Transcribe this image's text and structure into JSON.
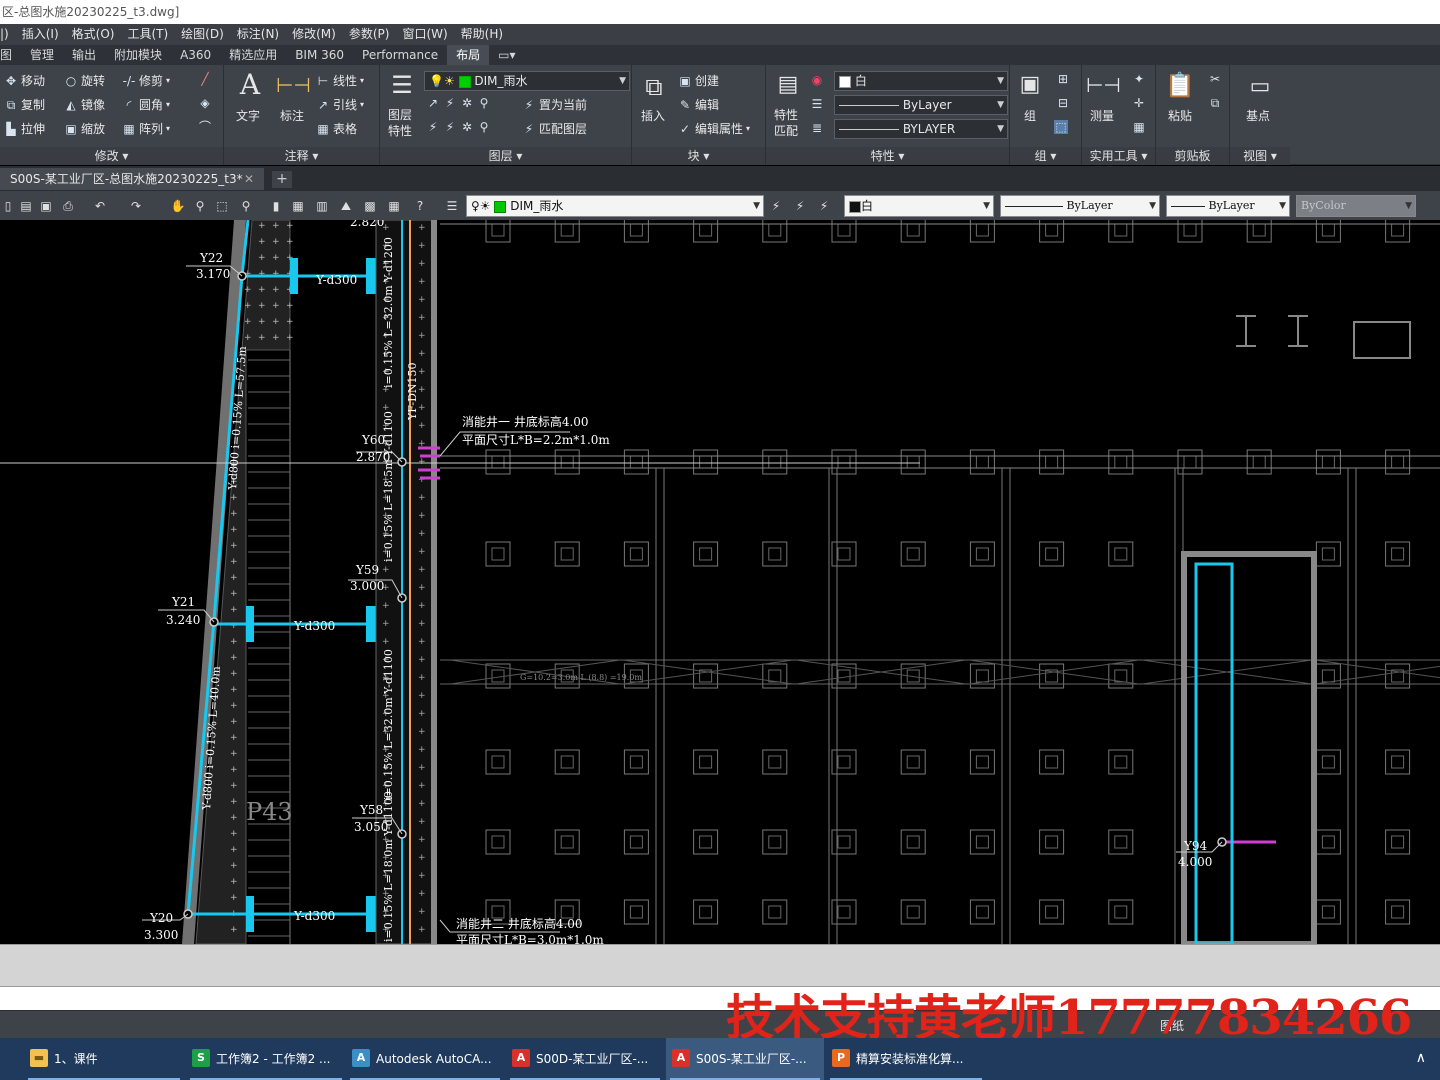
{
  "window": {
    "title": "区-总图水施20230225_t3.dwg]"
  },
  "menu": [
    "|)",
    "插入(I)",
    "格式(O)",
    "工具(T)",
    "绘图(D)",
    "标注(N)",
    "修改(M)",
    "参数(P)",
    "窗口(W)",
    "帮助(H)"
  ],
  "ribbon_tabs": [
    "图",
    "管理",
    "输出",
    "附加模块",
    "A360",
    "精选应用",
    "BIM 360",
    "Performance",
    "布局"
  ],
  "ribbon_active_tab": "布局",
  "ribbon": {
    "modify": {
      "title": "修改",
      "move": "移动",
      "rotate": "旋转",
      "trim": "修剪",
      "copy": "复制",
      "mirror": "镜像",
      "fillet": "圆角",
      "stretch": "拉伸",
      "scale": "缩放",
      "array": "阵列"
    },
    "annotation": {
      "title": "注释",
      "text": "文字",
      "dim": "标注",
      "linetype": "线性",
      "leader": "引线",
      "table": "表格"
    },
    "layers": {
      "title": "图层",
      "props": "图层\n特性",
      "current_layer": "DIM_雨水",
      "set_current": "置为当前",
      "match_layer": "匹配图层"
    },
    "block": {
      "title": "块",
      "insert": "插入",
      "create": "创建",
      "edit": "编辑",
      "edit_attr": "编辑属性"
    },
    "properties": {
      "title": "特性",
      "match": "特性\n匹配",
      "color": "白",
      "linetype": "ByLayer",
      "lineweight": "BYLAYER"
    },
    "groups": {
      "title": "组",
      "group": "组"
    },
    "utilities": {
      "title": "实用工具",
      "measure": "测量"
    },
    "clipboard": {
      "title": "剪贴板",
      "paste": "粘贴"
    },
    "view": {
      "title": "视图",
      "base": "基点"
    }
  },
  "doc_tab": {
    "label": "S00S-某工业厂区-总图水施20230225_t3*",
    "close": "✕",
    "new": "+"
  },
  "toolbar": {
    "layer": "DIM_雨水",
    "color": "白",
    "linetype": "ByLayer",
    "lineweight": "ByLayer",
    "plotstyle": "ByColor"
  },
  "drawing": {
    "labels": {
      "y22": "Y22",
      "y22_elev": "3.170",
      "y21": "Y21",
      "y21_elev": "3.240",
      "y20": "Y20",
      "y20_elev": "3.300",
      "y60": "Y60",
      "y60_elev": "2.870",
      "y59": "Y59",
      "y59_elev": "3.000",
      "y58": "Y58",
      "y58_elev": "3.050",
      "y94": "Y94",
      "y94_elev": "4.000",
      "top_elev": "2.820",
      "pipe_d300_a": "Y-d300",
      "pipe_d300_b": "Y-d300",
      "pipe_d300_c": "Y-d300",
      "well1_title": "消能井一 井底标高4.00",
      "well1_size": "平面尺寸L*B=2.2m*1.0m",
      "well2_title": "消能井二 井底标高4.00",
      "well2_size": "平面尺寸L*B=3.0m*1.0m",
      "v_1200": "i=0.15% L=32.0m   Y-d1200",
      "v_dn150": "YF-DN150",
      "v_1100a": "i=0.15% L=18.5m   Y-d1100",
      "v_1100b": "i=0.15% L=32.0m   Y-d1100",
      "v_1100c": "i=0.15% L=18.0m   Y-d1100",
      "v_d800a": "Y-d800   i=0.15% L=57.5m",
      "v_d800b": "Y-d800   i=0.15% L=40.0m",
      "p43": "P43",
      "grid_note": "G=10.2=3.0m L (8.8) =19.0m"
    }
  },
  "status": {
    "paper": "图纸"
  },
  "watermark": "技术支持黄老师17777834266（",
  "taskbar": [
    {
      "label": "1、课件",
      "icon": "folder-icon",
      "color": "#f2c14e"
    },
    {
      "label": "工作簿2 - 工作簿2 ...",
      "icon": "spreadsheet-icon",
      "color": "#1f9e4a"
    },
    {
      "label": "Autodesk AutoCA...",
      "icon": "autocad-setup-icon",
      "color": "#3c8fc4"
    },
    {
      "label": "S00D-某工业厂区-...",
      "icon": "autocad-icon",
      "color": "#d9302c"
    },
    {
      "label": "S00S-某工业厂区-...",
      "icon": "autocad-icon",
      "color": "#d9302c"
    },
    {
      "label": "精算安装标准化算...",
      "icon": "app-icon",
      "color": "#e86a1f"
    }
  ]
}
